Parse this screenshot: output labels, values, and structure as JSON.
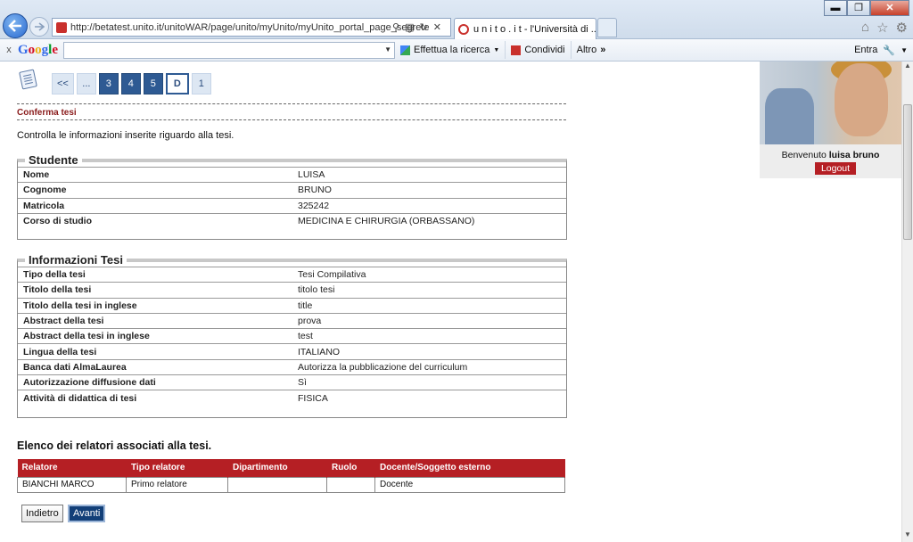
{
  "browser": {
    "url": "http://betatest.unito.it/unitoWAR/page/unito/myUnito/myUnito_portal_page_segrete",
    "tab_title": "u n i t o . i t - l'Università di ...",
    "tab_close": "×",
    "minimize": "▬",
    "maximize": "❐",
    "close": "✕"
  },
  "google_toolbar": {
    "close": "x",
    "logo": [
      "G",
      "o",
      "o",
      "g",
      "l",
      "e"
    ],
    "search_value": "",
    "search_action": "Effettua la ricerca",
    "share": "Condividi",
    "more": "Altro",
    "login": "Entra"
  },
  "steps": [
    "<<",
    "...",
    "3",
    "4",
    "5",
    "D",
    "1"
  ],
  "section_title": "Conferma tesi",
  "intro": "Controlla le informazioni inserite riguardo alla tesi.",
  "studente": {
    "legend": "Studente",
    "rows": [
      {
        "label": "Nome",
        "value": "LUISA"
      },
      {
        "label": "Cognome",
        "value": "BRUNO"
      },
      {
        "label": "Matricola",
        "value": "325242"
      },
      {
        "label": "Corso di studio",
        "value": "MEDICINA E CHIRURGIA (ORBASSANO)"
      }
    ]
  },
  "tesi": {
    "legend": "Informazioni Tesi",
    "rows": [
      {
        "label": "Tipo della tesi",
        "value": "Tesi Compilativa"
      },
      {
        "label": "Titolo della tesi",
        "value": "titolo tesi"
      },
      {
        "label": "Titolo della tesi in inglese",
        "value": "title"
      },
      {
        "label": "Abstract della tesi",
        "value": "prova"
      },
      {
        "label": "Abstract della tesi in inglese",
        "value": "test"
      },
      {
        "label": "Lingua della tesi",
        "value": "ITALIANO"
      },
      {
        "label": "Banca dati AlmaLaurea",
        "value": "Autorizza la pubblicazione del curriculum"
      },
      {
        "label": "Autorizzazione diffusione dati",
        "value": "Sì"
      },
      {
        "label": "Attività di didattica di tesi",
        "value": "FISICA"
      }
    ]
  },
  "relatori": {
    "title": "Elenco dei relatori associati alla tesi.",
    "columns": [
      "Relatore",
      "Tipo relatore",
      "Dipartimento",
      "Ruolo",
      "Docente/Soggetto esterno"
    ],
    "rows": [
      [
        "BIANCHI MARCO",
        "Primo relatore",
        "",
        "",
        "Docente"
      ]
    ]
  },
  "buttons": {
    "back": "Indietro",
    "next": "Avanti"
  },
  "user": {
    "welcome_prefix": "Benvenuto",
    "name": "luisa bruno",
    "logout": "Logout"
  }
}
